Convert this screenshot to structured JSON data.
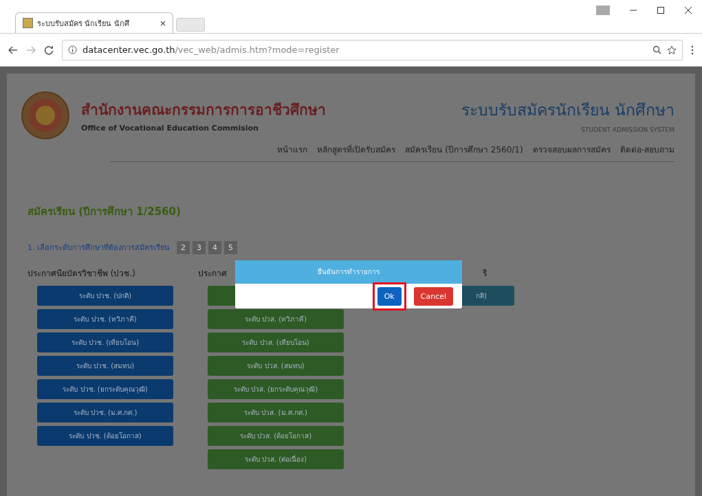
{
  "browser": {
    "tab_title": "ระบบรับสมัคร นักเรียน นักศึ",
    "url_host": "datacenter.vec.go.th",
    "url_path": "/vec_web/admis.htm?mode=register"
  },
  "header": {
    "org_thai": "สำนักงานคณะกรรมการการอาชีวศึกษา",
    "org_english": "Office of Vocational Education Commision",
    "system_thai": "ระบบรับสมัครนักเรียน นักศึกษา",
    "system_english": "STUDENT ADMISSION SYSTEM"
  },
  "nav": [
    "หน้าแรก",
    "หลักสูตรที่เปิดรับสมัคร",
    "สมัครเรียน (ปีการศึกษา 2560/1)",
    "ตรวจสอบผลการสมัคร",
    "ติดต่อ-สอบถาม"
  ],
  "page_title": "สมัครเรียน (ปีการศึกษา 1/2560)",
  "steps": [
    {
      "label": "1. เลือกระดับการศึกษาที่ต้องการสมัครเรียน",
      "selected": true
    },
    {
      "label": "2",
      "selected": false
    },
    {
      "label": "3",
      "selected": false
    },
    {
      "label": "4",
      "selected": false
    },
    {
      "label": "5",
      "selected": false
    }
  ],
  "columns": [
    {
      "heading": "ประกาศนียบัตรวิชาชีพ (ปวช.)",
      "color": "#0a3a6e",
      "buttons": [
        "ระดับ ปวช. (ปกติ)",
        "ระดับ ปวช. (ทวิภาคี)",
        "ระดับ ปวช. (เทียบโอน)",
        "ระดับ ปวช. (สมทบ)",
        "ระดับ ปวช. (ยกระดับคุณวุฒิ)",
        "ระดับ ปวช. (ม.ศ.กศ.)",
        "ระดับ ปวช. (ด้อยโอกาส)"
      ]
    },
    {
      "heading": "ประกาศ",
      "color": "#2e5a25",
      "first_covered": true,
      "buttons": [
        "ระดับ ปวส. (ทวิภาคี)",
        "ระดับ ปวส. (เทียบโอน)",
        "ระดับ ปวส. (สมทบ)",
        "ระดับ ปวส. (ยกระดับคุณวุฒิ)",
        "ระดับ ปวส. (ม.ศ.กศ.)",
        "ระดับ ปวส. (ด้อยโอกาส)",
        "ระดับ ปวส. (ต่อเนื่อง)"
      ]
    },
    {
      "heading": "รี",
      "color": "#1e4e5e",
      "buttons": [
        "กติ)"
      ]
    }
  ],
  "dialog": {
    "title": "ยืนยันการทำรายการ",
    "buttons": [
      {
        "label": "Ok",
        "kind": "primary",
        "highlighted": true
      },
      {
        "label": "Cancel",
        "kind": "danger",
        "highlighted": false
      }
    ]
  }
}
